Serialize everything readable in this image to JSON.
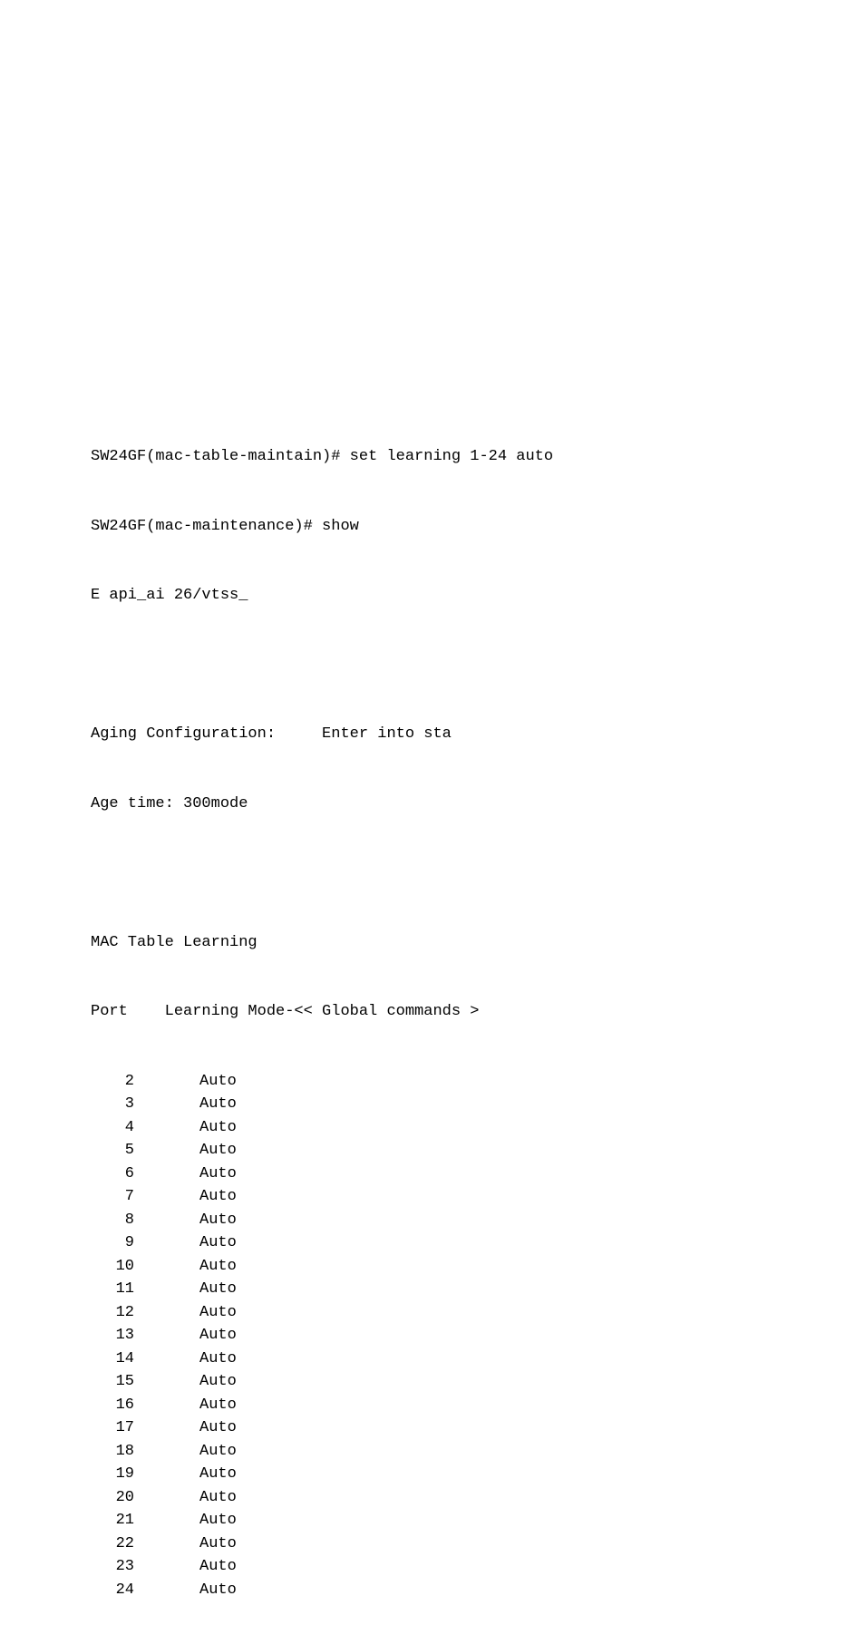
{
  "lines": {
    "l1": "SW24GF(mac-table-maintain)# set learning 1-24 auto",
    "l2": "SW24GF(mac-maintenance)# show",
    "l3": "E api_ai 26/vtss_",
    "blank1": "",
    "l4": "Aging Configuration:     Enter into sta",
    "l5": "Age time: 300mode",
    "blank2": "",
    "l6": "MAC Table Learning",
    "l7": "Port    Learning Mode-<< Global commands >"
  },
  "table": [
    {
      "port": "2",
      "mode": "Auto"
    },
    {
      "port": "3",
      "mode": "Auto"
    },
    {
      "port": "4",
      "mode": "Auto"
    },
    {
      "port": "5",
      "mode": "Auto"
    },
    {
      "port": "6",
      "mode": "Auto"
    },
    {
      "port": "7",
      "mode": "Auto"
    },
    {
      "port": "8",
      "mode": "Auto"
    },
    {
      "port": "9",
      "mode": "Auto"
    },
    {
      "port": "10",
      "mode": "Auto"
    },
    {
      "port": "11",
      "mode": "Auto"
    },
    {
      "port": "12",
      "mode": "Auto"
    },
    {
      "port": "13",
      "mode": "Auto"
    },
    {
      "port": "14",
      "mode": "Auto"
    },
    {
      "port": "15",
      "mode": "Auto"
    },
    {
      "port": "16",
      "mode": "Auto"
    },
    {
      "port": "17",
      "mode": "Auto"
    },
    {
      "port": "18",
      "mode": "Auto"
    },
    {
      "port": "19",
      "mode": "Auto"
    },
    {
      "port": "20",
      "mode": "Auto"
    },
    {
      "port": "21",
      "mode": "Auto"
    },
    {
      "port": "22",
      "mode": "Auto"
    },
    {
      "port": "23",
      "mode": "Auto"
    },
    {
      "port": "24",
      "mode": "Auto"
    }
  ]
}
